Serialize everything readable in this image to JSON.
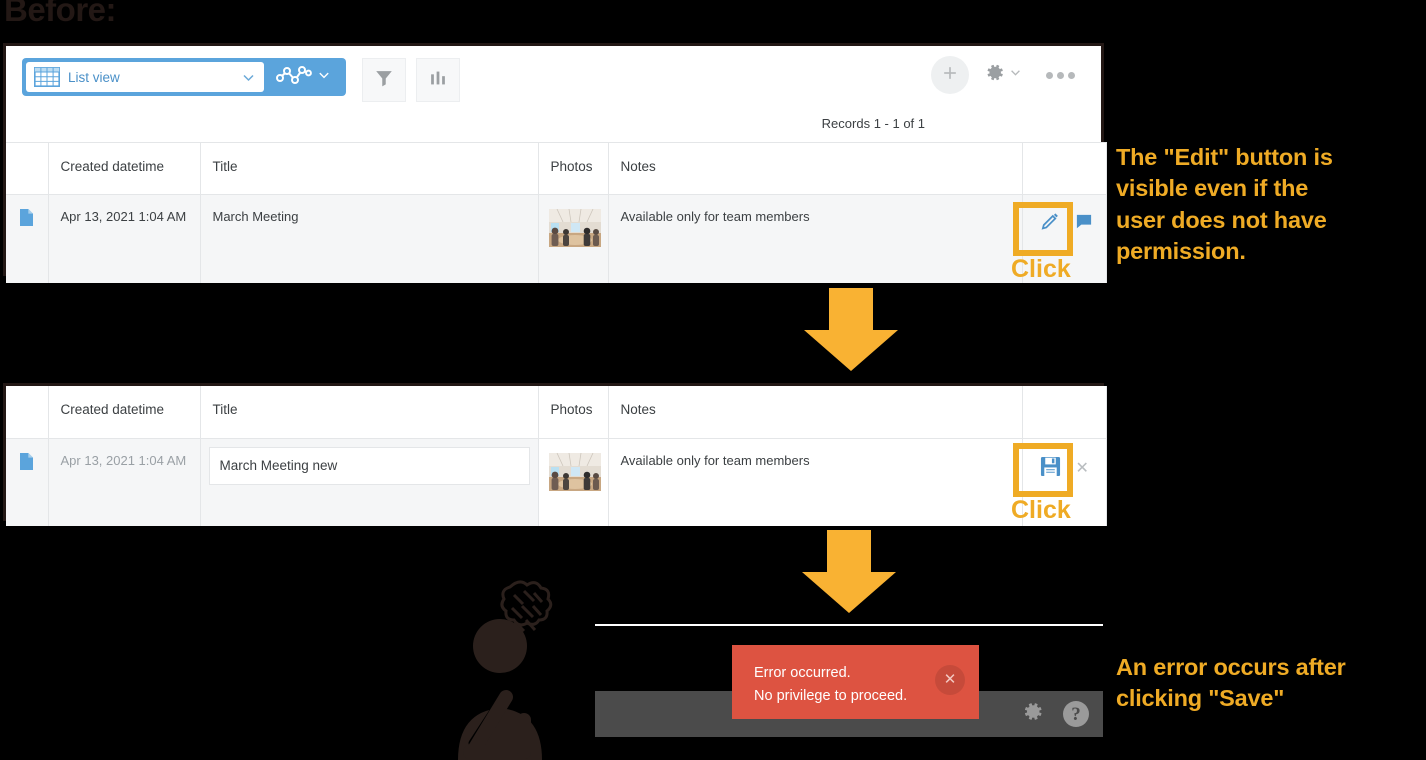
{
  "page": {
    "caption_before": "Before:",
    "background_color": "#000000",
    "accent_color": "#efab25",
    "error_color": "#dd5341",
    "brand_blue": "#5ba4dc"
  },
  "toolbar": {
    "view_label": "List view",
    "grid_icon": "grid-table-icon",
    "view_chevron_icon": "chevron-down-icon",
    "graph_icon": "line-graph-icon",
    "graph_chevron_icon": "chevron-down-icon",
    "filter_icon": "funnel-filter-icon",
    "chart_icon": "bar-chart-icon",
    "add_icon": "plus-icon",
    "gear_icon": "gear-icon",
    "gear_chevron_icon": "chevron-down-icon",
    "more_icon": "ellipsis-icon"
  },
  "records_status": "Records 1 - 1 of 1",
  "table": {
    "columns": [
      "",
      "Created datetime",
      "Title",
      "Photos",
      "Notes",
      ""
    ],
    "before_row": {
      "flag_icon": "document-icon",
      "created": "Apr 13, 2021 1:04 AM",
      "title": "March Meeting",
      "photo_alt": "meeting-room-thumbnail",
      "notes": "Available only for team members",
      "action_icon": "pencil-edit-icon",
      "secondary_icon": "comment-icon"
    },
    "after_row": {
      "flag_icon": "document-icon",
      "created": "Apr 13, 2021 1:04 AM",
      "title": "March Meeting new",
      "photo_alt": "meeting-room-thumbnail",
      "notes": "Available only for team members",
      "action_icon": "floppy-save-icon",
      "secondary_icon": "close-x-icon"
    }
  },
  "callouts": {
    "click_edit": "Click",
    "click_save": "Click",
    "annotation_top": "The \"Edit\" button is\nvisible even if the\nuser does not have\npermission.",
    "annotation_bottom": "An error occurs after\nclicking \"Save\""
  },
  "error_toast": {
    "line1": "Error occurred.",
    "line2": "No privilege to proceed.",
    "close_icon": "close-x-icon"
  },
  "footer_bar": {
    "gear_icon": "gear-icon",
    "help_icon": "question-help-icon",
    "help_glyph": "?"
  },
  "person": {
    "figure_icon": "frustrated-person-icon",
    "thought_icon": "anger-cloud-icon"
  },
  "arrows": {
    "arrow1_icon": "arrow-down-icon",
    "arrow2_icon": "arrow-down-icon"
  }
}
